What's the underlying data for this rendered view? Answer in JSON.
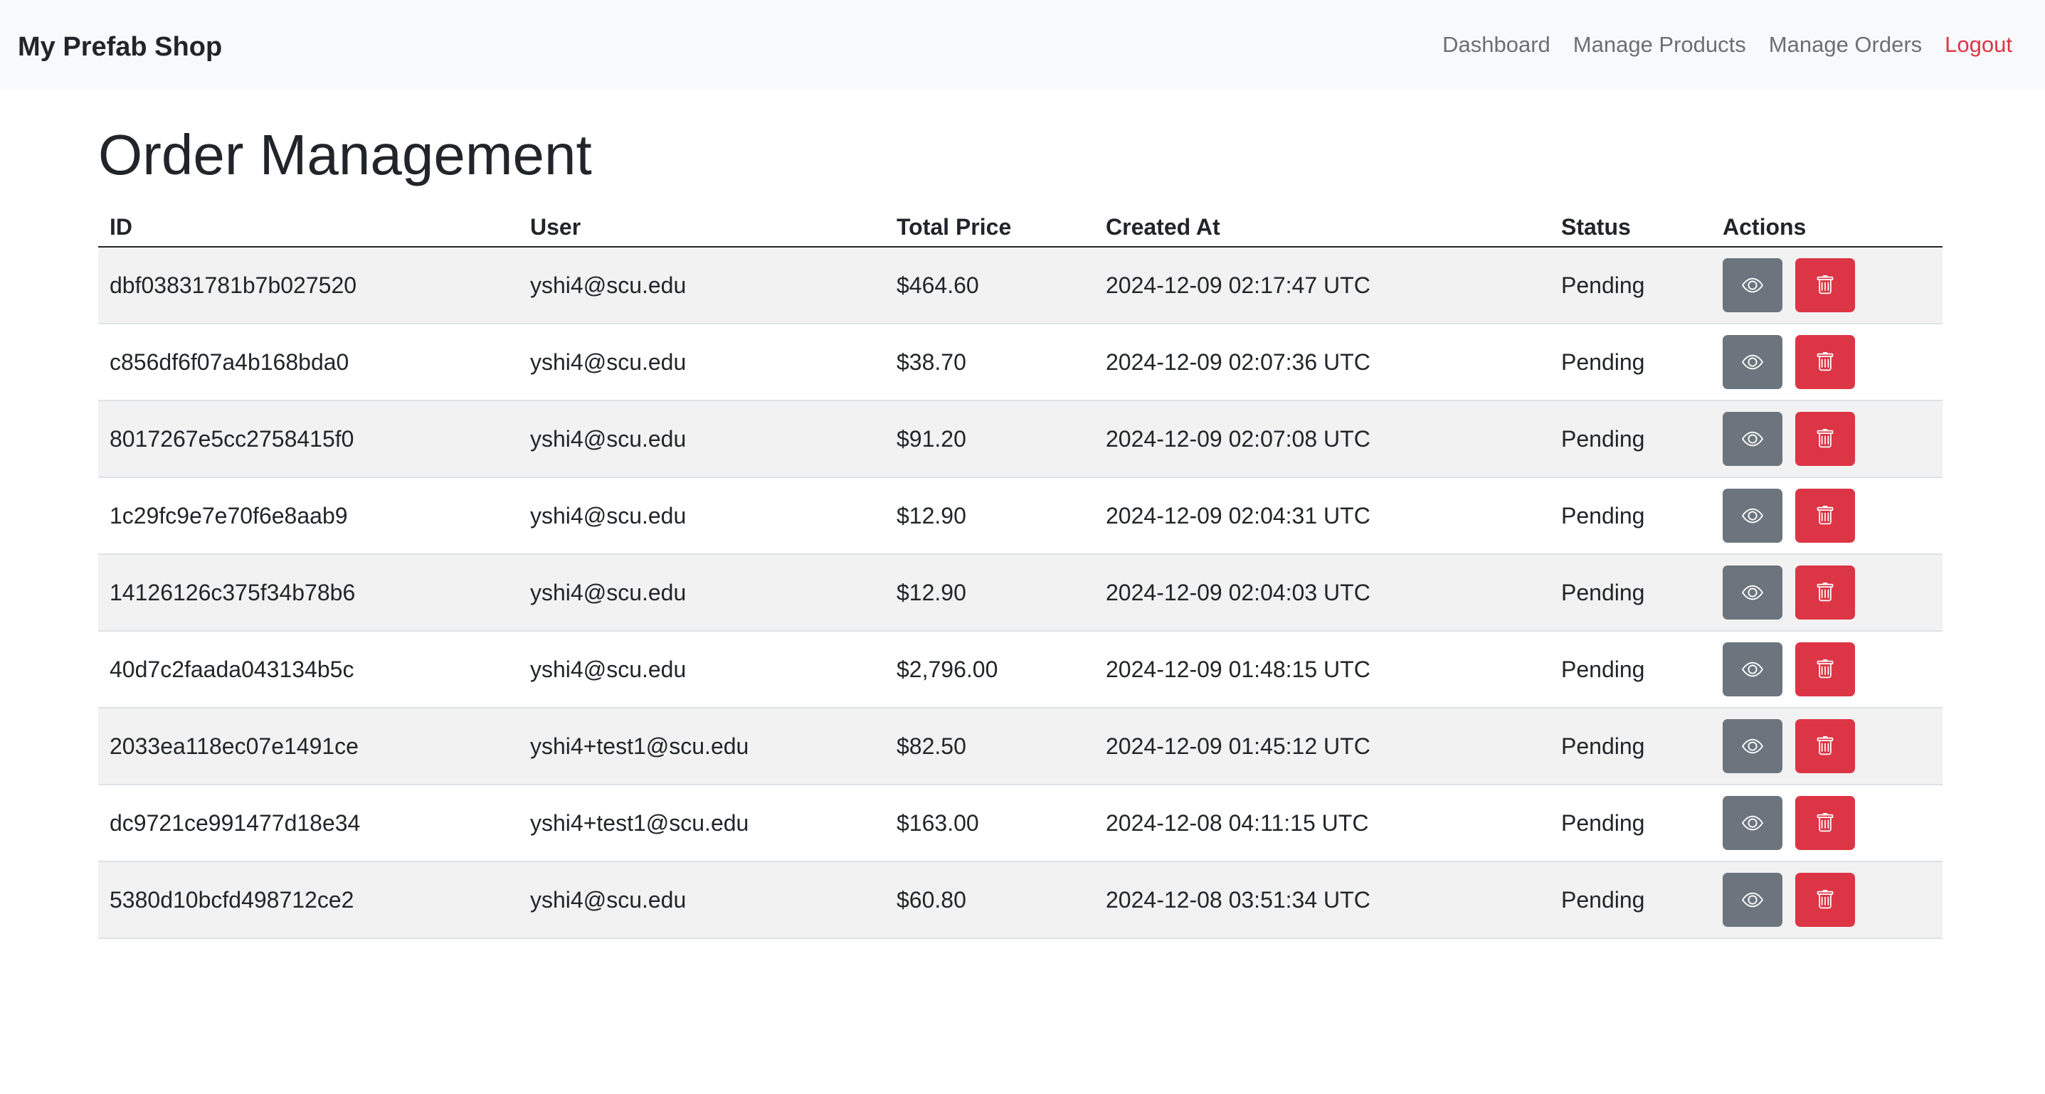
{
  "navbar": {
    "brand": "My Prefab Shop",
    "links": {
      "dashboard": "Dashboard",
      "manage_products": "Manage Products",
      "manage_orders": "Manage Orders",
      "logout": "Logout"
    }
  },
  "page": {
    "title": "Order Management"
  },
  "table": {
    "headers": {
      "id": "ID",
      "user": "User",
      "total_price": "Total Price",
      "created_at": "Created At",
      "status": "Status",
      "actions": "Actions"
    },
    "rows": [
      {
        "id": "dbf03831781b7b027520",
        "user": "yshi4@scu.edu",
        "total": "$464.60",
        "created": "2024-12-09 02:17:47 UTC",
        "status": "Pending"
      },
      {
        "id": "c856df6f07a4b168bda0",
        "user": "yshi4@scu.edu",
        "total": "$38.70",
        "created": "2024-12-09 02:07:36 UTC",
        "status": "Pending"
      },
      {
        "id": "8017267e5cc2758415f0",
        "user": "yshi4@scu.edu",
        "total": "$91.20",
        "created": "2024-12-09 02:07:08 UTC",
        "status": "Pending"
      },
      {
        "id": "1c29fc9e7e70f6e8aab9",
        "user": "yshi4@scu.edu",
        "total": "$12.90",
        "created": "2024-12-09 02:04:31 UTC",
        "status": "Pending"
      },
      {
        "id": "14126126c375f34b78b6",
        "user": "yshi4@scu.edu",
        "total": "$12.90",
        "created": "2024-12-09 02:04:03 UTC",
        "status": "Pending"
      },
      {
        "id": "40d7c2faada043134b5c",
        "user": "yshi4@scu.edu",
        "total": "$2,796.00",
        "created": "2024-12-09 01:48:15 UTC",
        "status": "Pending"
      },
      {
        "id": "2033ea118ec07e1491ce",
        "user": "yshi4+test1@scu.edu",
        "total": "$82.50",
        "created": "2024-12-09 01:45:12 UTC",
        "status": "Pending"
      },
      {
        "id": "dc9721ce991477d18e34",
        "user": "yshi4+test1@scu.edu",
        "total": "$163.00",
        "created": "2024-12-08 04:11:15 UTC",
        "status": "Pending"
      },
      {
        "id": "5380d10bcfd498712ce2",
        "user": "yshi4@scu.edu",
        "total": "$60.80",
        "created": "2024-12-08 03:51:34 UTC",
        "status": "Pending"
      }
    ],
    "action_icons": {
      "view": "eye-icon",
      "delete": "trash-icon"
    }
  },
  "colors": {
    "view_button": "#6c757d",
    "delete_button": "#dc3545",
    "logout_link": "#dc3545",
    "striped_row": "#f2f2f2",
    "navbar_bg": "#f8f9fa"
  }
}
